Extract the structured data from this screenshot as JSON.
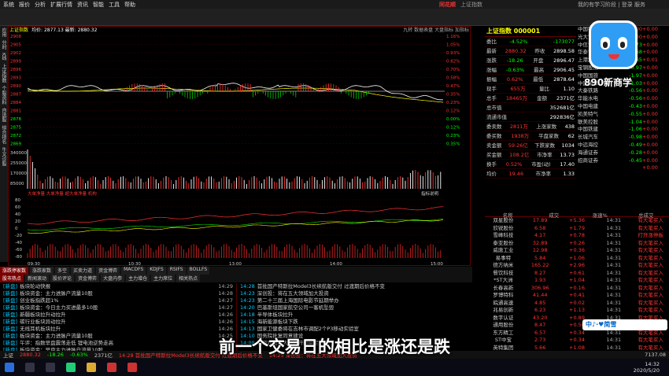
{
  "menu": {
    "items": [
      "系统",
      "报价",
      "分析",
      "扩展行情",
      "资讯",
      "智能",
      "工具",
      "帮助"
    ],
    "logo": "同花顺",
    "window": "上证指数",
    "right": "我的有学习阶段 | 登录 服务"
  },
  "toolbar": [
    "",
    "",
    "",
    "",
    "",
    "",
    "",
    "",
    "",
    "",
    "",
    "",
    "",
    "",
    "",
    "",
    "",
    "",
    "",
    "",
    "",
    "",
    "",
    "",
    "",
    "",
    "",
    "",
    "",
    ""
  ],
  "leftbar": [
    "应用",
    "分时",
    "K线",
    "上证指数",
    "个股资料",
    "自选股",
    "综合排名",
    "牛叉诊股"
  ],
  "chart": {
    "header_tag": "上证指数",
    "header": "均价: 2877.13 最新: 2880.32",
    "header_right": "九转 数据表盘 大盘指标 加指标",
    "price_labels": [
      "2908",
      "2905",
      "2902",
      "2899",
      "2896",
      "2893",
      "2890",
      "2887",
      "2884",
      "2881",
      "2878",
      "2875",
      "2872",
      "2869"
    ],
    "pct_labels": [
      "1.16%",
      "1.05%",
      "0.93%",
      "0.82%",
      "0.70%",
      "0.58%",
      "0.47%",
      "0.35%",
      "0.23%",
      "0.12%",
      "0.00%",
      "0.12%",
      "0.23%",
      "0.35%",
      "0.47%",
      "0.58%",
      "0.70%",
      "0.82%",
      "0.93%",
      "1.05%"
    ],
    "vol_labels": [
      "340000",
      "255000",
      "170000",
      "85000"
    ],
    "vol_unit": "万",
    "indicator_title": "大单净量 大单净量 超大单净量 机构",
    "indicator_right": "指标说明",
    "ind_labels": [
      "80",
      "60",
      "40",
      "20",
      "0",
      "-20",
      "-40",
      "-60",
      "-80"
    ],
    "time_labels": [
      "09:30",
      "10:30",
      "13:00",
      "14:00",
      "15:00"
    ]
  },
  "right_panel": {
    "title": "上证指数 000001",
    "rows": [
      {
        "l": "委比",
        "v": "-4.52%",
        "l2": "",
        "v2": "-173077"
      },
      {
        "l": "最新",
        "v": "2880.32",
        "l2": "昨收",
        "v2": "2898.58"
      },
      {
        "l": "涨跌",
        "v": "-18.26",
        "l2": "开盘",
        "v2": "2896.47"
      },
      {
        "l": "涨幅",
        "v": "-0.63%",
        "l2": "最高",
        "v2": "2906.45"
      },
      {
        "l": "振幅",
        "v": "0.62%",
        "l2": "最低",
        "v2": "2878.64"
      },
      {
        "l": "现手",
        "v": "655万",
        "l2": "量比",
        "v2": "1.10"
      },
      {
        "l": "总手",
        "v": "18465万",
        "l2": "金额",
        "v2": "2371亿"
      },
      {
        "l": "总市值",
        "v": "",
        "l2": "",
        "v2": "352681亿"
      },
      {
        "l": "流通市值",
        "v": "",
        "l2": "",
        "v2": "292836亿"
      },
      {
        "l": "委卖数",
        "v": "2811万",
        "l2": "上涨家数",
        "v2": "438"
      },
      {
        "l": "委买数",
        "v": "1938万",
        "l2": "平盘家数",
        "v2": "62"
      },
      {
        "l": "卖金额",
        "v": "59.26亿",
        "l2": "下跌家数",
        "v2": "1034"
      },
      {
        "l": "买金额",
        "v": "108.2亿",
        "l2": "市净率",
        "v2": "13.73"
      },
      {
        "l": "换手",
        "v": "0.52%",
        "l2": "市盈(动)",
        "v2": "17.40"
      },
      {
        "l": "均价",
        "v": "19.46",
        "l2": "市净率",
        "v2": "1.33"
      }
    ]
  },
  "stock_list": [
    {
      "n": "中国银河",
      "v": "+0.00"
    },
    {
      "n": "光大证券",
      "v": "+0.00"
    },
    {
      "n": "中信证券",
      "v": "-0.73"
    },
    {
      "n": "华泰证券",
      "v": "-0.68"
    },
    {
      "n": "上港集团",
      "v": "-0.65"
    },
    {
      "n": "宝钢股份",
      "v": "-0.97"
    },
    {
      "n": "中国国旅",
      "v": "-1.97"
    },
    {
      "n": "中国中车",
      "v": "-1.03"
    },
    {
      "n": "大秦铁路",
      "v": "-0.56"
    },
    {
      "n": "华能水电",
      "v": "-0.56"
    },
    {
      "n": "中国电建",
      "v": "-0.43"
    },
    {
      "n": "凯美特气",
      "v": "-0.55"
    },
    {
      "n": "联美控股",
      "v": "-1.04"
    },
    {
      "n": "中国铁建",
      "v": "-1.06"
    },
    {
      "n": "长城汽车",
      "v": "-0.98"
    },
    {
      "n": "中远海控",
      "v": "-0.49"
    },
    {
      "n": "海通证券",
      "v": "-0.28"
    },
    {
      "n": "招商证券",
      "v": "-0.45"
    }
  ],
  "far_right": [
    "+0.00",
    "+0.00",
    "+0.00",
    "+0.00",
    "+0.01",
    "+0.00",
    "+0.00",
    "+0.00",
    "+0.00",
    "+0.00",
    "+0.00",
    "+0.00",
    "+0.00",
    "+0.00",
    "+0.00",
    "+0.00",
    "+0.00",
    "+0.00",
    "+0.00"
  ],
  "trade": {
    "headers": [
      "名称",
      "成交",
      "涨速%",
      "总成交"
    ],
    "rows": [
      {
        "n": "双星股份",
        "p": "17.89",
        "c": "+5.36"
      },
      {
        "n": "欣锐股份",
        "p": "6.58",
        "c": "+1.79"
      },
      {
        "n": "雪峰科技",
        "p": "4.17",
        "c": "+0.78"
      },
      {
        "n": "泰亚股份",
        "p": "32.89",
        "c": "+0.26"
      },
      {
        "n": "威唐工业",
        "p": "12.98",
        "c": "+0.36"
      },
      {
        "n": "易事特",
        "p": "5.84",
        "c": "+1.06"
      },
      {
        "n": "德方纳米",
        "p": "165.22",
        "c": "+2.96"
      },
      {
        "n": "餐饮科技",
        "p": "8.27",
        "c": "+0.61"
      },
      {
        "n": "*ST大洲",
        "p": "1.93",
        "c": "+1.04"
      },
      {
        "n": "长春高新",
        "p": "306.96",
        "c": "+0.16"
      },
      {
        "n": "罗博特科",
        "p": "41.44",
        "c": "+0.41"
      },
      {
        "n": "皖通高速",
        "p": "4.85",
        "c": "+0.02"
      },
      {
        "n": "兆易创新",
        "p": "6.23",
        "c": "+1.13"
      },
      {
        "n": "数字认证",
        "p": "43.20",
        "c": "+0.89"
      },
      {
        "n": "通用股份",
        "p": "8.47",
        "c": "+0.50"
      },
      {
        "n": "东方精工",
        "p": "6.57",
        "c": "+0.34"
      },
      {
        "n": "ST中宝",
        "p": "2.73",
        "c": "+0.34"
      },
      {
        "n": "英特集团",
        "p": "5.66",
        "c": "+1.08"
      },
      {
        "n": "青岛港",
        "p": "5.86",
        "c": "+0.16"
      }
    ],
    "times": [
      "14:31",
      "14:31",
      "14:31",
      "14:31",
      "14:31",
      "14:31",
      "14:31",
      "14:31",
      "14:31",
      "14:31",
      "14:31",
      "14:31",
      "14:31",
      "14:31",
      "14:31",
      "14:31",
      "14:31",
      "14:31",
      "14:31"
    ],
    "desc": [
      "有大笔买入",
      "有大笔买入",
      "打开涨停板",
      "有大笔买入",
      "有大笔买入",
      "有大笔买入",
      "有大笔买入",
      "有大笔买入",
      "有大笔买入",
      "有大笔买入",
      "有大笔买入",
      "有大笔买入",
      "有大笔买入",
      "有大笔买入",
      "有大笔买入",
      "有大笔买入",
      "有大笔买入",
      "有大笔买入",
      "有大笔买入"
    ]
  },
  "news_tabs": [
    "涨跌停家数",
    "涨跌家数",
    "多空",
    "买卖力道",
    "资金博弈",
    "MACDFS",
    "KDJFS",
    "RSIFS",
    "BOLLFS"
  ],
  "news_tabs2": [
    "股市热点",
    "新闻滚动",
    "股价评论",
    "资金博弈",
    "大盘内参",
    "主力增仓",
    "主力席位",
    "相关热点"
  ],
  "news_left": [
    {
      "b": "[新盘]",
      "t": "板块轮动快报",
      "tm": "14:29"
    },
    {
      "b": "[新盘]",
      "t": "板块资金：主力进脉户流量10股",
      "tm": "14:28"
    },
    {
      "b": "[新盘]",
      "t": "创业板指跌超1%",
      "tm": "14:27"
    },
    {
      "b": "[新盘]",
      "t": "板块资金：今日主力买进最多10股",
      "tm": "14:27"
    },
    {
      "b": "[新盘]",
      "t": "新疆板块拉升动拉升",
      "tm": "14:26"
    },
    {
      "b": "[新盘]",
      "t": "碳行业板块异动拉升",
      "tm": "14:26"
    },
    {
      "b": "[新盘]",
      "t": "无线耳机板块拉升",
      "tm": "14:26"
    },
    {
      "b": "[新盘]",
      "t": "板块资金：主力进脉户流量10股",
      "tm": "14:25"
    },
    {
      "b": "[新盘]",
      "t": "午评：指数早盘震荡走低 锂电池逆势走高",
      "tm": "14:25"
    },
    {
      "b": "[新盘]",
      "t": "板块资金：早盘主力进脉户流量10股",
      "tm": "14:22"
    }
  ],
  "news_right": [
    {
      "b": "14:28",
      "t": "首批国产特斯拉Model3长续航版交付 过渡期后价格不变"
    },
    {
      "b": "14:23",
      "t": "深创投：将在五大领域加大投资"
    },
    {
      "b": "14:23",
      "t": "第二十三届上海国际电影节延期举办"
    },
    {
      "b": "14:20",
      "t": "巴基斯坦国家航空公司一客机坠毁"
    },
    {
      "b": "14:18",
      "t": "半导体板块拉升"
    },
    {
      "b": "14:15",
      "t": "海新能源板块下跌"
    },
    {
      "b": "14:13",
      "t": "国家卫健委将在吉林市调配2个P3移动实验室"
    },
    {
      "b": "14:10",
      "t": "国务院批复同意建设"
    },
    {
      "b": "14:08",
      "t": "特斯拉股东大会召开时间定"
    }
  ],
  "status": {
    "index": "上证",
    "val": "2880.32",
    "chg": "-18.26",
    "pct": "-0.63%",
    "amt": "2371亿",
    "ticker": "14:28 首批国产特斯拉Model3长续航版交付 过渡期后价格不变",
    "ticker2": "14:25 深创投：将在五大领域加大投资",
    "right": "7137.08"
  },
  "taskbar": {
    "time": "14:32",
    "date": "2020/5/20"
  },
  "subtitle": "前一个交易日的相比是涨还是跌",
  "brand": "890新商学",
  "watermark": "中♪·♥简雪"
}
